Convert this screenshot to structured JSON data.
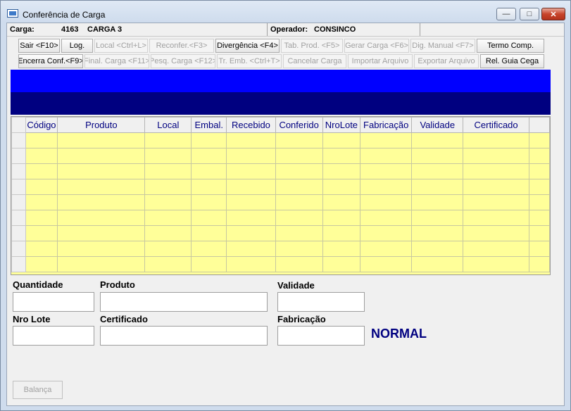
{
  "window": {
    "title": "Conferência de Carga"
  },
  "infobar": {
    "carga_label": "Carga:",
    "carga_number": "4163",
    "carga_name": "CARGA 3",
    "operador_label": "Operador:",
    "operador_value": "CONSINCO"
  },
  "toolbar": {
    "row1": [
      {
        "label": "Sair <F10>",
        "enabled": true
      },
      {
        "label": "Log.",
        "enabled": true
      },
      {
        "label": "Local <Ctrl+L>",
        "enabled": false
      },
      {
        "label": "Reconfer.<F3>",
        "enabled": false
      },
      {
        "label": "Divergência <F4>",
        "enabled": true
      },
      {
        "label": "Tab. Prod. <F5>",
        "enabled": false
      },
      {
        "label": "Gerar Carga <F6>",
        "enabled": false
      },
      {
        "label": "Dig. Manual <F7>",
        "enabled": false
      },
      {
        "label": "Termo Comp.",
        "enabled": true
      }
    ],
    "row2": [
      {
        "label": "Encerra Conf.<F9>",
        "enabled": true
      },
      {
        "label": "Final. Carga <F11>",
        "enabled": false
      },
      {
        "label": "Pesq. Carga <F12>",
        "enabled": false
      },
      {
        "label": "Tr. Emb. <Ctrl+T>",
        "enabled": false
      },
      {
        "label": "Cancelar Carga",
        "enabled": false
      },
      {
        "label": "Importar Arquivo",
        "enabled": false
      },
      {
        "label": "Exportar Arquivo",
        "enabled": false
      },
      {
        "label": "Rel. Guia Cega",
        "enabled": true
      }
    ]
  },
  "grid": {
    "columns": [
      "Código",
      "Produto",
      "Local",
      "Embal.",
      "Recebido",
      "Conferido",
      "NroLote",
      "Fabricação",
      "Validade",
      "Certificado"
    ],
    "empty_rows": 9
  },
  "form": {
    "quantidade_label": "Quantidade",
    "produto_label": "Produto",
    "validade_label": "Validade",
    "nro_lote_label": "Nro Lote",
    "certificado_label": "Certificado",
    "fabricacao_label": "Fabricação",
    "quantidade_value": "",
    "produto_value": "",
    "validade_value": "",
    "nro_lote_value": "",
    "certificado_value": "",
    "fabricacao_value": ""
  },
  "status_text": "NORMAL",
  "balanca_label": "Balança",
  "colors": {
    "band_top": "#0000ff",
    "band_bottom": "#000080",
    "grid_bg": "#ffff99",
    "header_text": "#000080"
  }
}
